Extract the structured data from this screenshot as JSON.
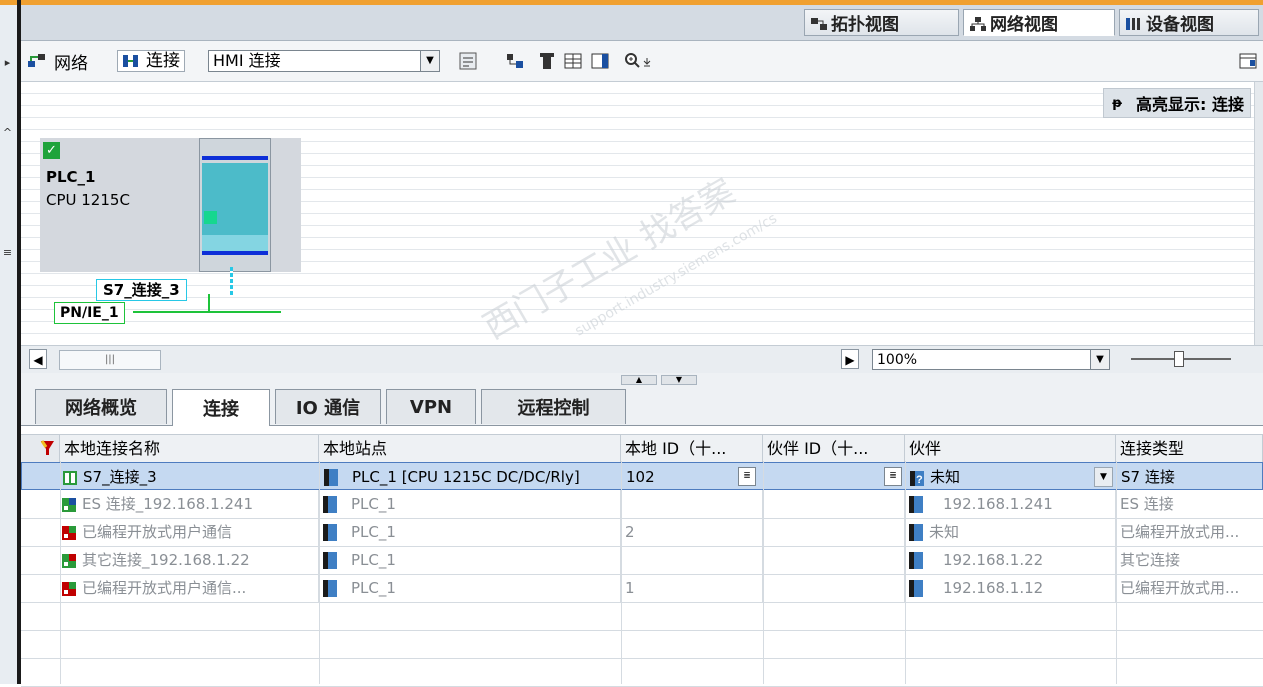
{
  "view_tabs": {
    "topology": "拓扑视图",
    "network": "网络视图",
    "device": "设备视图"
  },
  "toolbar": {
    "network_label": "网络",
    "connections_label": "连接",
    "connection_type_value": "HMI 连接"
  },
  "canvas": {
    "highlight_label": "高亮显示: 连接",
    "device_name": "PLC_1",
    "device_type": "CPU 1215C",
    "connection_label": "S7_连接_3",
    "subnet_label": "PN/IE_1",
    "watermark_main": "西门子工业 找答案",
    "watermark_url": "support.industry.siemens.com/cs"
  },
  "zoom": {
    "value": "100%"
  },
  "bottom_tabs": [
    "网络概览",
    "连接",
    "IO 通信",
    "VPN",
    "远程控制"
  ],
  "table": {
    "headers": [
      "本地连接名称",
      "本地站点",
      "本地 ID（十...",
      "伙伴 ID（十...",
      "伙伴",
      "连接类型"
    ],
    "rows": [
      {
        "name": "S7_连接_3",
        "station": "PLC_1 [CPU 1215C DC/DC/Rly]",
        "local_id": "102",
        "partner_id": "",
        "partner": "未知",
        "type": "S7 连接",
        "icon": "s7-connection-icon"
      },
      {
        "name": "ES 连接_192.168.1.241",
        "station": "PLC_1",
        "local_id": "",
        "partner_id": "",
        "partner": "192.168.1.241",
        "type": "ES 连接",
        "icon": "es-connection-icon"
      },
      {
        "name": "已编程开放式用户通信",
        "station": "PLC_1",
        "local_id": "2",
        "partner_id": "",
        "partner": "未知",
        "type": "已编程开放式用...",
        "icon": "open-comm-icon"
      },
      {
        "name": "其它连接_192.168.1.22",
        "station": "PLC_1",
        "local_id": "",
        "partner_id": "",
        "partner": "192.168.1.22",
        "type": "其它连接",
        "icon": "other-connection-icon"
      },
      {
        "name": "已编程开放式用户通信...",
        "station": "PLC_1",
        "local_id": "1",
        "partner_id": "",
        "partner": "192.168.1.12",
        "type": "已编程开放式用...",
        "icon": "open-comm-icon"
      }
    ]
  },
  "colors": {
    "accent_top": "#f0a030",
    "selection": "#c5d9f1",
    "connection_line": "#27c8e6",
    "subnet_line": "#1ec33a"
  }
}
